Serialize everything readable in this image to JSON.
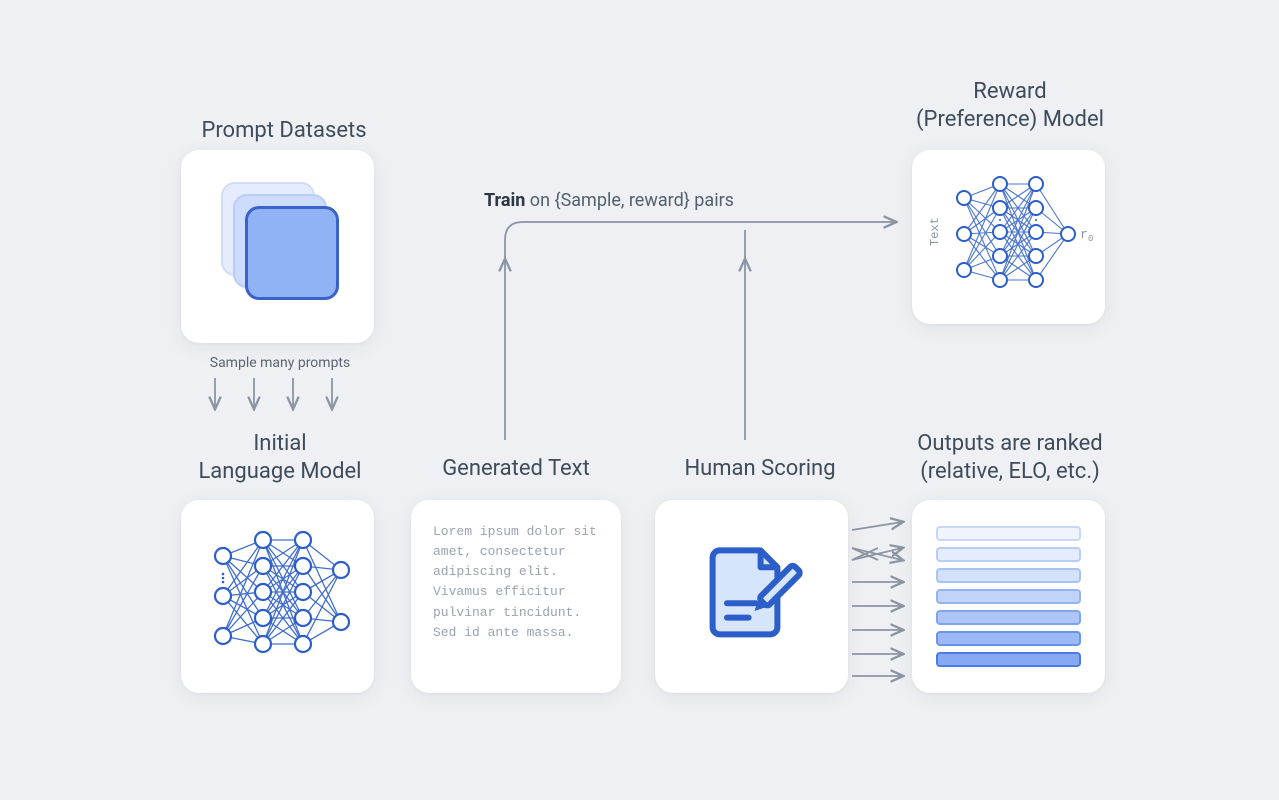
{
  "labels": {
    "prompt_datasets": "Prompt Datasets",
    "sample_prompts": "Sample many prompts",
    "initial_lm_line1": "Initial",
    "initial_lm_line2": "Language Model",
    "generated_text": "Generated Text",
    "human_scoring": "Human Scoring",
    "reward_line1": "Reward",
    "reward_line2": "(Preference) Model",
    "ranked_line1": "Outputs are ranked",
    "ranked_line2": "(relative, ELO, etc.)",
    "train_prefix": "Train",
    "train_rest": " on {Sample, reward} pairs",
    "reward_input": "Text",
    "reward_output": "r",
    "reward_output_sub": "0"
  },
  "generated_sample": "Lorem ipsum dolor sit amet, consectetur adipiscing elit. Vivamus efficitur pulvinar tincidunt. Sed id ante massa.",
  "ranked_bars": [
    {
      "fill": "#eff4fe",
      "stroke": "#c6d7fb"
    },
    {
      "fill": "#e4ecfd",
      "stroke": "#b8cdf8"
    },
    {
      "fill": "#d3e1fb",
      "stroke": "#a8c2f6"
    },
    {
      "fill": "#c0d3f9",
      "stroke": "#94b4f3"
    },
    {
      "fill": "#adc6f7",
      "stroke": "#7fa5f0"
    },
    {
      "fill": "#9bb9f5",
      "stroke": "#6a94ec"
    },
    {
      "fill": "#86a9f2",
      "stroke": "#4b7be6"
    }
  ],
  "colors": {
    "arrow": "#8b95a3",
    "nn_stroke": "#2c5ec9",
    "nn_fill": "#ffffff",
    "scoring_fill": "#d6e4fc",
    "scoring_stroke": "#2c5ec9"
  }
}
